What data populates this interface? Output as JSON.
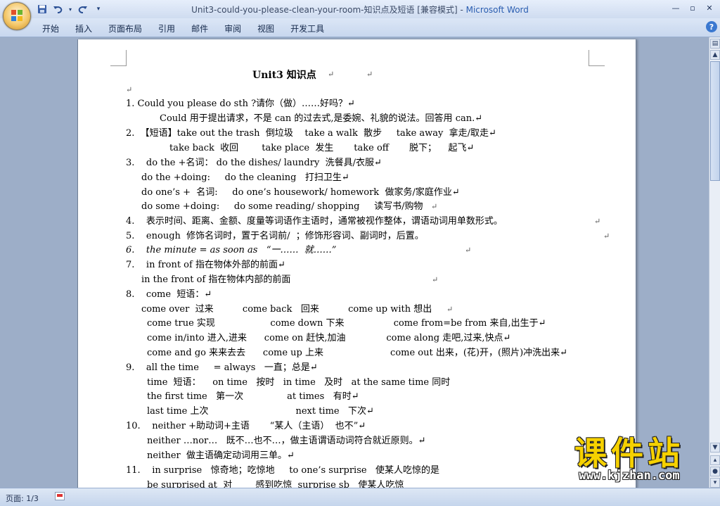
{
  "window": {
    "title": "Unit3-could-you-please-clean-your-room-知识点及短语 [兼容模式] - ",
    "app_name": "Microsoft Word",
    "controls": [
      "—",
      "▫",
      "✕"
    ]
  },
  "qat": {
    "save_icon": "save-icon",
    "undo_icon": "undo-icon",
    "redo_icon": "redo-icon",
    "customize_icon": "customize-qat-icon"
  },
  "ribbon": {
    "tabs": [
      "开始",
      "插入",
      "页面布局",
      "引用",
      "邮件",
      "审阅",
      "视图",
      "开发工具"
    ],
    "help_label": "?"
  },
  "document": {
    "title": "Unit3   知识点",
    "lines": [
      "↵",
      "1. Could you please do sth ?请你（做）……好吗？↵",
      "Could 用于提出请求，不是 can 的过去式,是委婉、礼貌的说法。回答用 can.↵",
      "2.  【短语】take out the trash  倒垃圾    take a walk  散步     take away  拿走/取走↵",
      "take back  收回        take place  发生       take off       脱下；    起飞↵",
      "3.    do the +名词： do the dishes/ laundry  洗餐具/衣服↵",
      "do the +doing:     do the cleaning   打扫卫生↵",
      "do one’s +  名词:     do one’s housework/ homework  做家务/家庭作业↵",
      "do some +doing:     do some reading/ shopping     读写书/购物",
      "4.    表示时间、距离、金额、度量等词语作主语时，通常被视作整体，谓语动词用单数形式。",
      "5.    enough  修饰名词时，置于名词前/  ；修饰形容词、副词时，后置。",
      "6.    the minute = as soon as   “一……  就……”",
      "7.    in front of 指在物体外部的前面↵",
      "in the front of 指在物体内部的前面",
      "8.    come  短语：↵",
      "come over  过来          come back   回来          come up with 想出",
      "come true 实现                   come down 下来                 come from=be from 来自,出生于↵",
      "come in/into 进入,进来      come on 赶快,加油              come along 走吧,过来,快点↵",
      "come and go 来来去去      come up 上来                       come out 出来，(花)开，(照片)冲洗出来↵",
      "9.    all the time     = always   一直；总是↵",
      "time  短语：    on time   按时   in time   及时   at the same time 同时",
      "the first time   第一次               at times   有时↵",
      "last time 上次                              next time   下次↵",
      "10.    neither +助动词+主语       “某人（主语）  也不”↵",
      "neither …nor…   既不…也不…，做主语谓语动词符合就近原则。↵",
      "neither  做主语确定动词用三单。↵",
      "11.    in surprise   惊奇地；吃惊地     to one’s surprise   使某人吃惊的是",
      "be surprised at  对        感到吃惊  surprise sb   使某人吃惊"
    ],
    "trailing_marks": [
      "↵",
      "↵",
      "↵",
      "↵",
      "↵",
      "↵",
      "↵",
      "↵"
    ]
  },
  "status": {
    "page_label": "页面: 1/3"
  },
  "watermark": {
    "cn": "课件站",
    "url": "www.kjzhan.com"
  }
}
